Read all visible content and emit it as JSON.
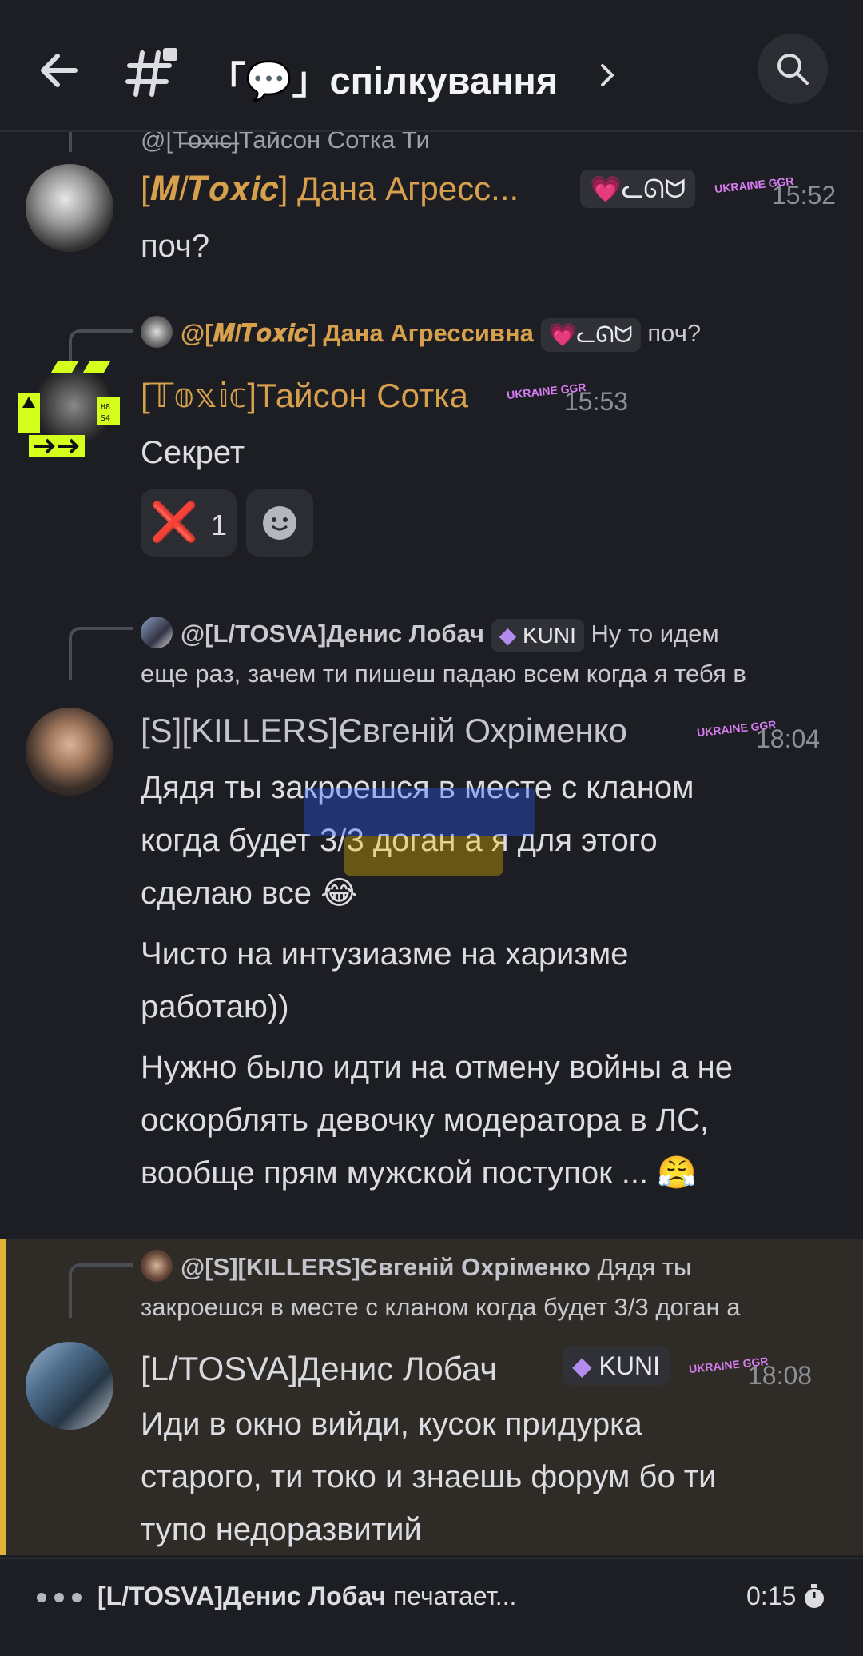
{
  "header": {
    "channel_name": "「💬」спілкування"
  },
  "top_partial": {
    "reply_text": "@[T̶o̶x̶i̶c̶]Тайсон Сотка Ти"
  },
  "messages": [
    {
      "author": "[𝑴/𝑻𝒐𝒙𝒊𝒄] Дана Агресс...",
      "tag": "💗ᓚᘏᗢ",
      "time": "15:52",
      "text": "поч?"
    },
    {
      "reply_name": "@[𝑴/𝑻𝒐𝒙𝒊𝒄] Дана Агрессивна",
      "reply_tag": "💗ᓚᘏᗢ",
      "reply_text": "поч?",
      "author": "[𝕋𝕠𝕩𝕚𝕔]Тайсон Сотка",
      "time": "15:53",
      "text": "Секрет",
      "reaction_emoji": "❌",
      "reaction_count": "1"
    },
    {
      "reply_name": "@[L/TOSVA]Денис Лобач",
      "reply_tag": "KUNI",
      "reply_text_1": "Ну то идем",
      "reply_text_2": "еще раз, зачем ти пишеш падаю всем когда я тебя в",
      "author": "[S][KILLERS]Євгеній Охріменко",
      "time": "18:04",
      "line_1": "Дядя ты закроешся в месте с кланом",
      "line_2": "когда будет 3/3 доган а я для этого",
      "line_3": "сделаю все 😂",
      "line_4": "Чисто на интузиазме на харизме",
      "line_5": "работаю))",
      "line_6": "Нужно было идти на отмену войны а не",
      "line_7": "оскорблять девочку модератора в ЛС,",
      "line_8": "вообще прям мужской поступок ... 😤"
    },
    {
      "reply_name": "@[S][KILLERS]Євгеній Охріменко",
      "reply_text_1": "Дядя ты",
      "reply_text_2": "закроешся в месте с кланом когда будет 3/3 доган а",
      "author": "[L/TOSVA]Денис Лобач",
      "tag": "KUNI",
      "time": "18:08",
      "line_1": "Иди в окно вийди, кусок придурка",
      "line_2": "старого, ти токо и знаешь форум бо ти",
      "line_3": "тупо недоразвитий"
    }
  ],
  "badge_text": "UKRAINE GGR",
  "typing": {
    "name": "[L/TOSVA]Денис Лобач",
    "suffix": "печатает...",
    "timer": "0:15"
  },
  "colors": {
    "toxic_name": "#d6a04c",
    "killers_name": "#c4c5cc",
    "highlight_border": "#e2b13c"
  }
}
